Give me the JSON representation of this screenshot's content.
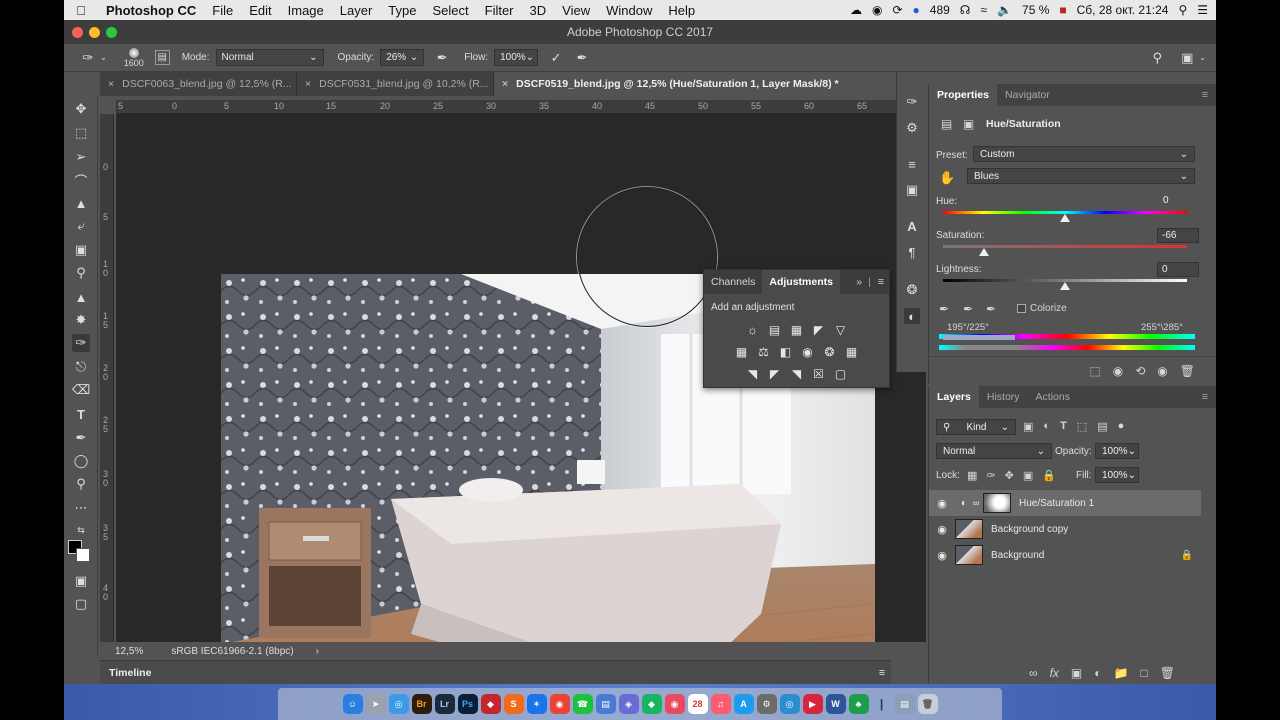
{
  "menubar": {
    "app": "Photoshop CC",
    "items": [
      "File",
      "Edit",
      "Image",
      "Layer",
      "Type",
      "Select",
      "Filter",
      "3D",
      "View",
      "Window",
      "Help"
    ],
    "badge_count": "489",
    "battery": "75 %",
    "datetime": "Сб, 28 окт.  21:24"
  },
  "window": {
    "title": "Adobe Photoshop CC 2017"
  },
  "options": {
    "brush_size": "1600",
    "mode_label": "Mode:",
    "mode_value": "Normal",
    "opacity_label": "Opacity:",
    "opacity_value": "26%",
    "flow_label": "Flow:",
    "flow_value": "100%"
  },
  "tabs": [
    {
      "label": "DSCF0063_blend.jpg @ 12,5% (R..."
    },
    {
      "label": "DSCF0531_blend.jpg @ 10,2% (R..."
    },
    {
      "label": "DSCF0519_blend.jpg @ 12,5% (Hue/Saturation 1, Layer Mask/8) *"
    }
  ],
  "ruler": {
    "h_ticks": [
      "5",
      "0",
      "5",
      "10",
      "15",
      "20",
      "25",
      "30",
      "35",
      "40",
      "45",
      "50",
      "55",
      "60",
      "65"
    ],
    "v_ticks": [
      "0",
      "5",
      "1\n0",
      "1\n5",
      "2\n0",
      "2\n5",
      "3\n0",
      "3\n5",
      "4\n0"
    ]
  },
  "float_panel": {
    "tabs": [
      "Channels",
      "Adjustments"
    ],
    "title": "Add an adjustment"
  },
  "status": {
    "zoom": "12,5%",
    "profile": "sRGB IEC61966-2.1 (8bpc)"
  },
  "timeline": {
    "label": "Timeline"
  },
  "properties": {
    "tabs": [
      "Properties",
      "Navigator"
    ],
    "adjustment_name": "Hue/Saturation",
    "preset_label": "Preset:",
    "preset_value": "Custom",
    "channel_value": "Blues",
    "hue_label": "Hue:",
    "hue_value": "0",
    "saturation_label": "Saturation:",
    "saturation_value": "-66",
    "lightness_label": "Lightness:",
    "lightness_value": "0",
    "colorize_label": "Colorize",
    "range_left": "195°/225°",
    "range_right": "255°\\285°"
  },
  "layers_panel": {
    "tabs": [
      "Layers",
      "History",
      "Actions"
    ],
    "kind_label": "Kind",
    "blend_mode": "Normal",
    "opacity_label": "Opacity:",
    "opacity_value": "100%",
    "lock_label": "Lock:",
    "fill_label": "Fill:",
    "fill_value": "100%",
    "layers": [
      {
        "name": "Hue/Saturation 1"
      },
      {
        "name": "Background copy"
      },
      {
        "name": "Background"
      }
    ]
  },
  "dock": {
    "calendar_day": "28"
  },
  "colors": {
    "panel_bg": "#535353",
    "canvas_bg": "#282828",
    "accent_blue": "#1473e6"
  }
}
